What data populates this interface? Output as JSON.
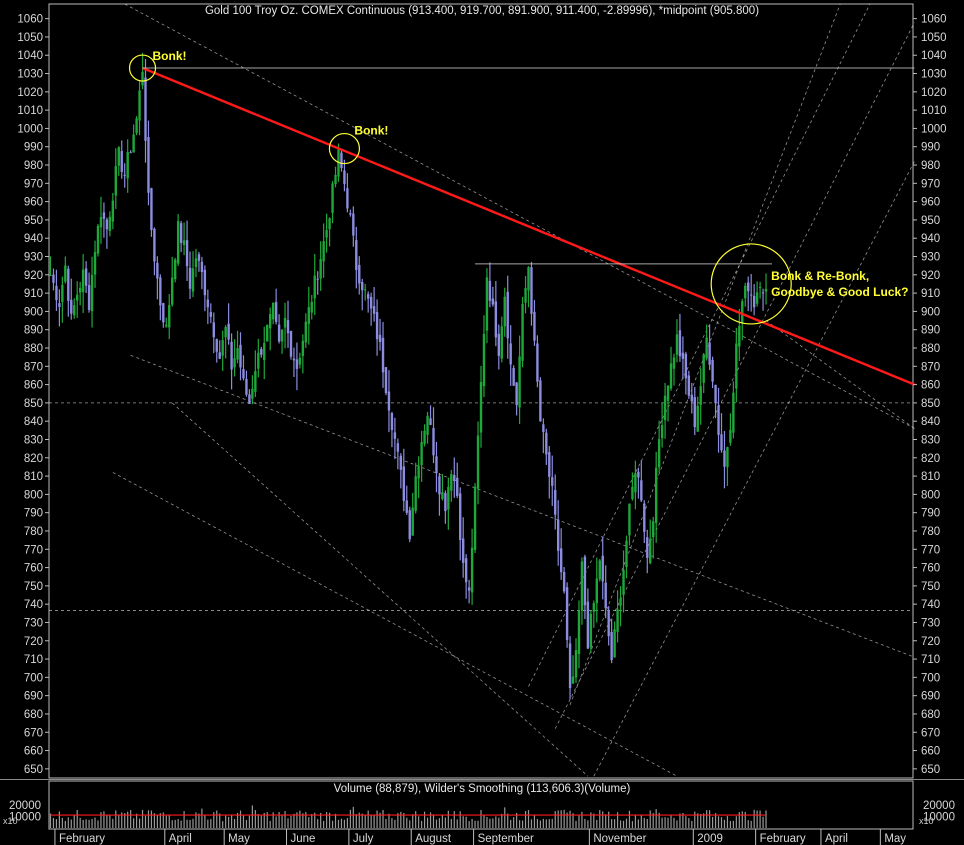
{
  "chart_data": {
    "type": "candlestick",
    "title": "Gold 100 Troy Oz. COMEX Continuous (913.400, 919.700, 891.900, 911.400, -2.89996), *midpoint (905.800)",
    "ylim": [
      645,
      1068
    ],
    "y_ticks": [
      650,
      660,
      670,
      680,
      690,
      700,
      710,
      720,
      730,
      740,
      750,
      760,
      770,
      780,
      790,
      800,
      810,
      820,
      830,
      840,
      850,
      860,
      870,
      880,
      890,
      900,
      910,
      920,
      930,
      940,
      950,
      960,
      970,
      980,
      990,
      1000,
      1010,
      1020,
      1030,
      1040,
      1050,
      1060
    ],
    "x_labels": [
      "February",
      "April",
      "May",
      "June",
      "July",
      "August",
      "September",
      "November",
      "2009",
      "February",
      "April",
      "May",
      "June"
    ],
    "colors": {
      "up": "#1fa83a",
      "down": "#8c8ce0",
      "trend": "#ff1a1a",
      "annotation": "#ffff33",
      "guide": "#cfcfcf"
    },
    "price_path": [
      [
        0,
        920
      ],
      [
        3,
        905
      ],
      [
        5,
        925
      ],
      [
        7,
        895
      ],
      [
        9,
        910
      ],
      [
        11,
        920
      ],
      [
        13,
        905
      ],
      [
        15,
        935
      ],
      [
        17,
        955
      ],
      [
        19,
        945
      ],
      [
        21,
        965
      ],
      [
        23,
        985
      ],
      [
        25,
        975
      ],
      [
        27,
        990
      ],
      [
        29,
        1005
      ],
      [
        31,
        1033
      ],
      [
        33,
        960
      ],
      [
        35,
        930
      ],
      [
        37,
        905
      ],
      [
        39,
        890
      ],
      [
        41,
        920
      ],
      [
        43,
        945
      ],
      [
        45,
        935
      ],
      [
        47,
        915
      ],
      [
        49,
        930
      ],
      [
        51,
        920
      ],
      [
        53,
        905
      ],
      [
        55,
        890
      ],
      [
        57,
        875
      ],
      [
        59,
        890
      ],
      [
        61,
        870
      ],
      [
        63,
        880
      ],
      [
        65,
        860
      ],
      [
        67,
        850
      ],
      [
        69,
        870
      ],
      [
        71,
        880
      ],
      [
        73,
        890
      ],
      [
        75,
        900
      ],
      [
        77,
        880
      ],
      [
        79,
        895
      ],
      [
        81,
        880
      ],
      [
        83,
        870
      ],
      [
        85,
        885
      ],
      [
        87,
        900
      ],
      [
        89,
        915
      ],
      [
        91,
        930
      ],
      [
        93,
        945
      ],
      [
        95,
        965
      ],
      [
        97,
        985
      ],
      [
        99,
        970
      ],
      [
        101,
        950
      ],
      [
        103,
        925
      ],
      [
        105,
        915
      ],
      [
        107,
        905
      ],
      [
        109,
        895
      ],
      [
        111,
        880
      ],
      [
        113,
        860
      ],
      [
        115,
        840
      ],
      [
        117,
        820
      ],
      [
        119,
        800
      ],
      [
        121,
        780
      ],
      [
        123,
        810
      ],
      [
        125,
        830
      ],
      [
        127,
        845
      ],
      [
        129,
        825
      ],
      [
        131,
        805
      ],
      [
        133,
        795
      ],
      [
        135,
        815
      ],
      [
        137,
        800
      ],
      [
        139,
        760
      ],
      [
        141,
        745
      ],
      [
        143,
        800
      ],
      [
        145,
        860
      ],
      [
        147,
        920
      ],
      [
        149,
        900
      ],
      [
        151,
        880
      ],
      [
        153,
        910
      ],
      [
        155,
        870
      ],
      [
        157,
        850
      ],
      [
        159,
        900
      ],
      [
        161,
        925
      ],
      [
        163,
        880
      ],
      [
        165,
        840
      ],
      [
        167,
        820
      ],
      [
        169,
        800
      ],
      [
        171,
        770
      ],
      [
        173,
        745
      ],
      [
        175,
        690
      ],
      [
        177,
        710
      ],
      [
        179,
        760
      ],
      [
        181,
        720
      ],
      [
        183,
        740
      ],
      [
        185,
        765
      ],
      [
        187,
        735
      ],
      [
        189,
        710
      ],
      [
        191,
        735
      ],
      [
        193,
        760
      ],
      [
        195,
        790
      ],
      [
        197,
        815
      ],
      [
        199,
        800
      ],
      [
        201,
        765
      ],
      [
        203,
        790
      ],
      [
        205,
        830
      ],
      [
        207,
        855
      ],
      [
        209,
        870
      ],
      [
        211,
        885
      ],
      [
        213,
        870
      ],
      [
        215,
        855
      ],
      [
        217,
        840
      ],
      [
        219,
        860
      ],
      [
        221,
        885
      ],
      [
        223,
        865
      ],
      [
        225,
        835
      ],
      [
        227,
        815
      ],
      [
        229,
        840
      ],
      [
        231,
        880
      ],
      [
        233,
        905
      ],
      [
        235,
        915
      ],
      [
        237,
        905
      ],
      [
        239,
        918
      ],
      [
        241,
        910
      ]
    ],
    "volume": {
      "label": "Volume (88,879), Wilder's Smoothing (113,606.3)(Volume)",
      "y_ticks": [
        10000,
        20000
      ],
      "ylim": [
        0,
        28000
      ],
      "scale_label": "x10",
      "smoothing_level": 11300,
      "smoothing_end": 241
    },
    "annotations": [
      {
        "text": "Bonk!",
        "at": [
          31,
          1033
        ]
      },
      {
        "text": "Bonk!",
        "at": [
          99,
          989
        ]
      },
      {
        "text": "Bonk & Re-Bonk,",
        "at": [
          236,
          915
        ]
      },
      {
        "text": "Goodbye & Good Luck?",
        "at": [
          236,
          915
        ]
      }
    ],
    "trend_line": {
      "from": [
        31,
        1033
      ],
      "to": [
        291,
        860
      ]
    },
    "horizontal_lines": [
      {
        "y": 1033,
        "x0": 31,
        "x1": 291
      },
      {
        "y": 926,
        "x0": 143,
        "x1": 243
      }
    ],
    "dashed_horizontal": [
      850,
      736.5
    ],
    "dashed_lines": [
      [
        [
          25,
          1068
        ],
        [
          291,
          836
        ]
      ],
      [
        [
          27,
          876
        ],
        [
          291,
          711
        ]
      ],
      [
        [
          41,
          850
        ],
        [
          181,
          646
        ]
      ],
      [
        [
          21,
          812
        ],
        [
          211,
          646
        ]
      ],
      [
        [
          161,
          695
        ],
        [
          276,
          1068
        ]
      ],
      [
        [
          170,
          672
        ],
        [
          291,
          1058
        ]
      ],
      [
        [
          183,
          646
        ],
        [
          291,
          982
        ]
      ],
      [
        [
          175,
          685
        ],
        [
          266,
          1068
        ]
      ],
      [
        [
          241,
          895
        ],
        [
          291,
          836
        ]
      ]
    ]
  }
}
